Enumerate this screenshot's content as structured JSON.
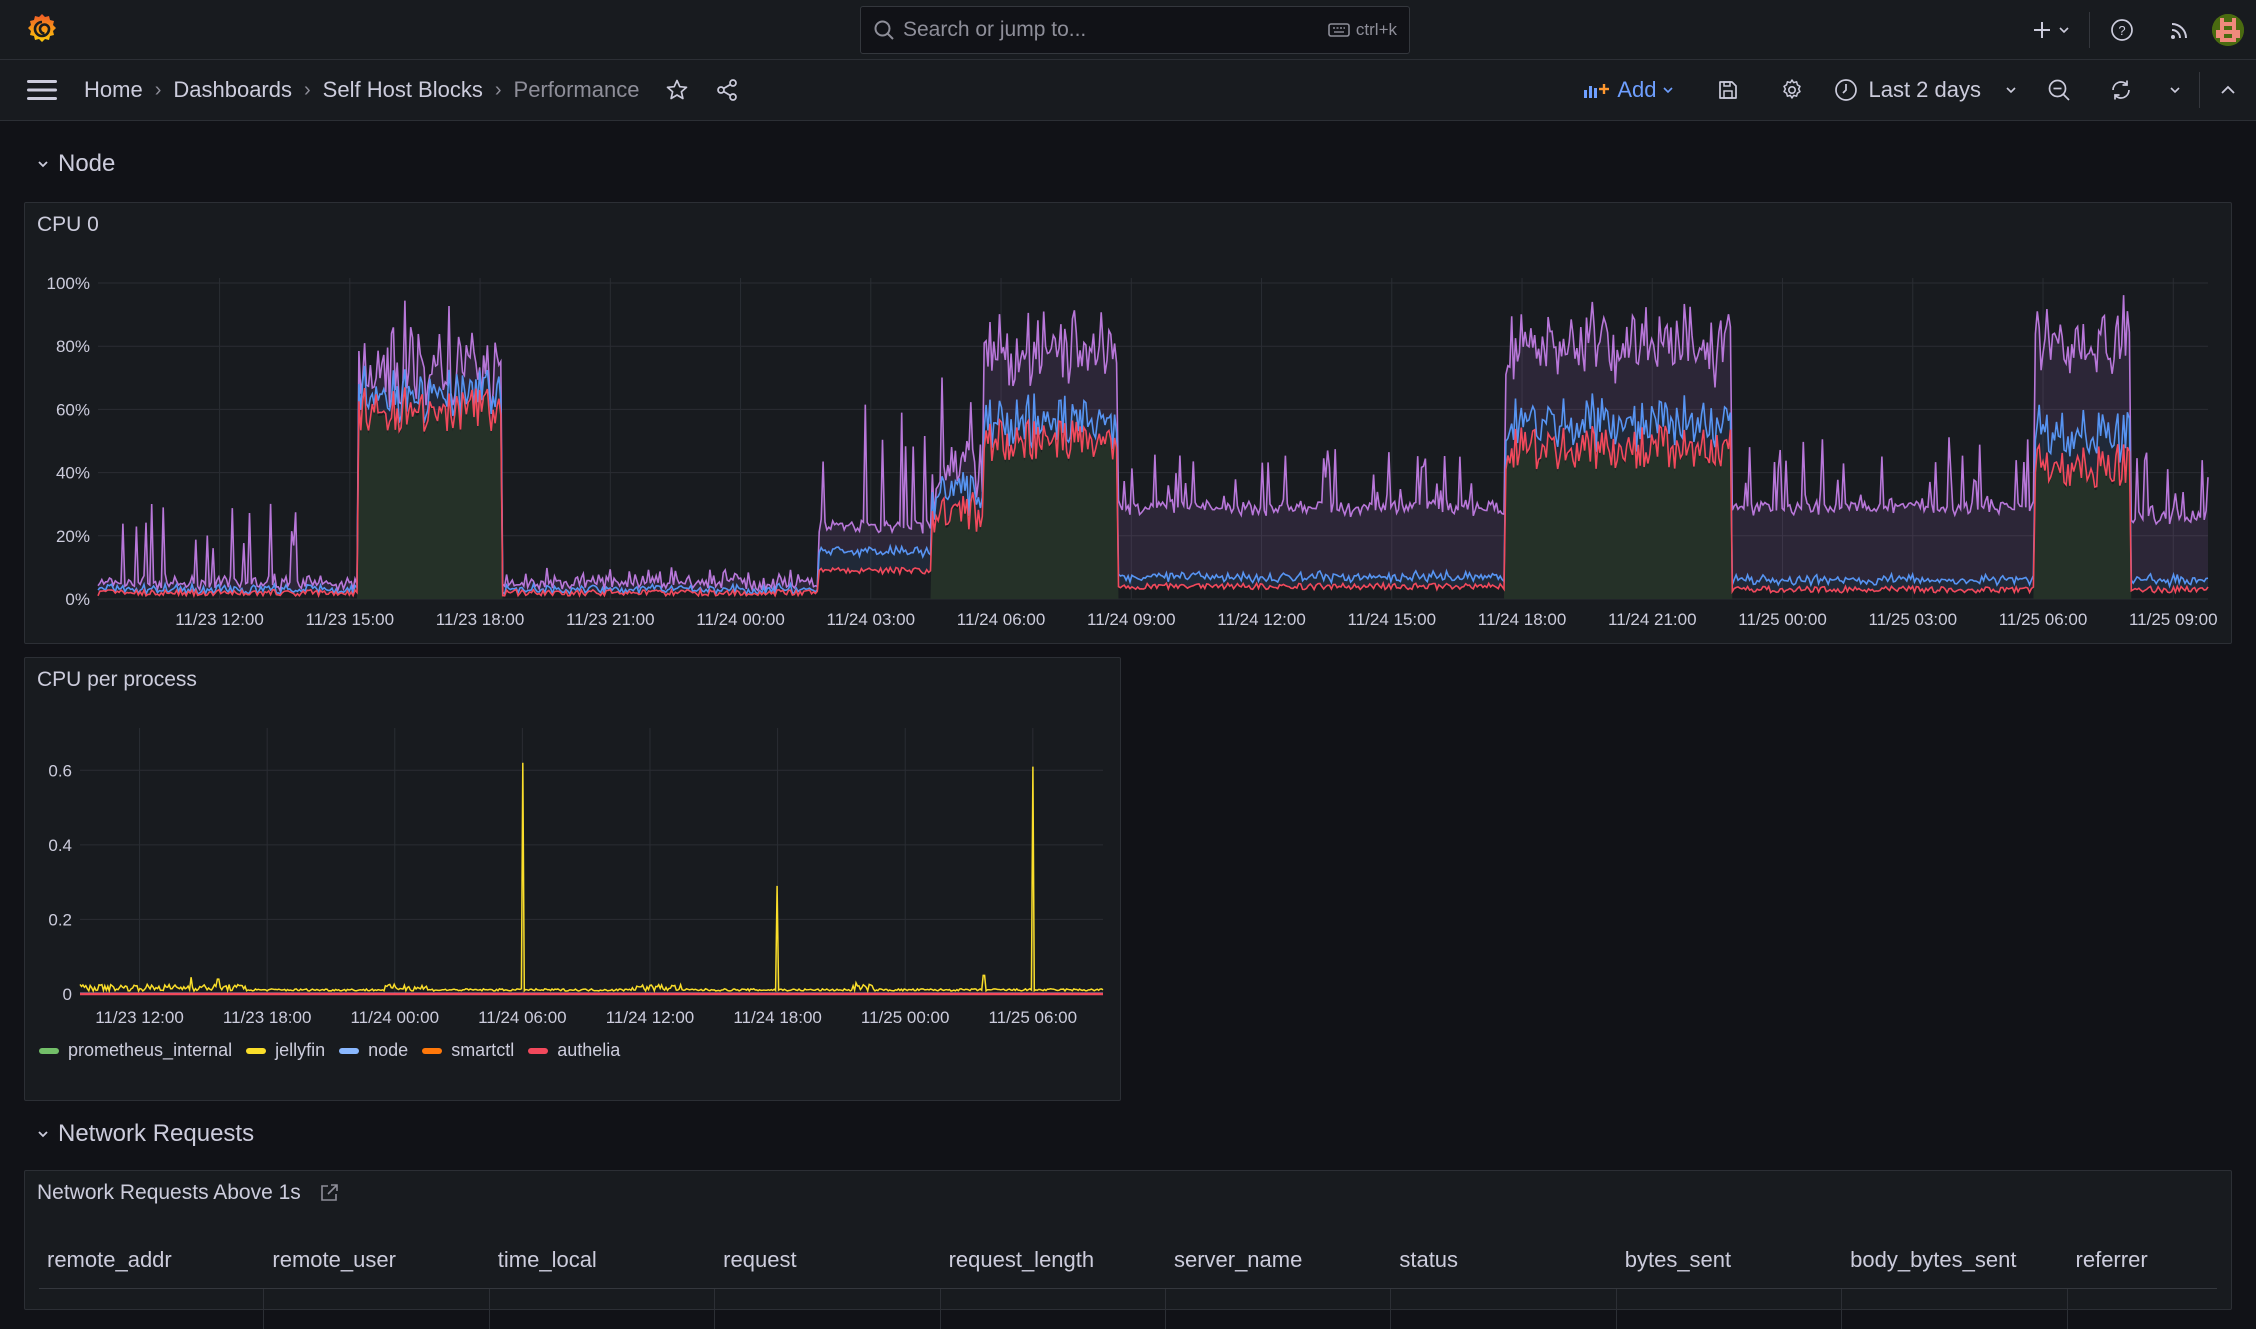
{
  "topbar": {
    "logo": "grafana-logo",
    "search_placeholder": "Search or jump to...",
    "search_shortcut": "ctrl+k",
    "icons": [
      "plus-icon",
      "chevron-down-icon",
      "help-icon",
      "rss-icon",
      "avatar"
    ]
  },
  "navbar": {
    "breadcrumbs": [
      "Home",
      "Dashboards",
      "Self Host Blocks",
      "Performance"
    ],
    "add_label": "Add",
    "time_range": "Last 2 days"
  },
  "rows": [
    {
      "title": "Node"
    },
    {
      "title": "Network Requests"
    }
  ],
  "panels": {
    "cpu0": {
      "title": "CPU 0"
    },
    "cpu_per_process": {
      "title": "CPU per process"
    },
    "network_requests": {
      "title": "Network Requests Above 1s",
      "columns": [
        "remote_addr",
        "remote_user",
        "time_local",
        "request",
        "request_length",
        "server_name",
        "status",
        "bytes_sent",
        "body_bytes_sent",
        "referrer"
      ]
    }
  },
  "colors": {
    "accent": "#6e9fff",
    "purple": "#b877d9",
    "blue": "#5794f2",
    "red": "#f2495c",
    "green_fill": "#253128",
    "jellyfin": "#fade2a",
    "prometheus_internal": "#73bf69",
    "node": "#8ab8ff",
    "smartctl": "#ff780a",
    "authelia": "#f2495c"
  },
  "chart_data": [
    {
      "type": "area",
      "title": "CPU 0",
      "ylabel": "",
      "xlabel": "",
      "ylim": [
        0,
        100
      ],
      "y_ticks": [
        "0%",
        "20%",
        "40%",
        "60%",
        "80%",
        "100%"
      ],
      "x_range_hours": [
        9.2,
        57.8
      ],
      "x_ticks": [
        {
          "h": 12,
          "label": "11/23 12:00"
        },
        {
          "h": 15,
          "label": "11/23 15:00"
        },
        {
          "h": 18,
          "label": "11/23 18:00"
        },
        {
          "h": 21,
          "label": "11/23 21:00"
        },
        {
          "h": 24,
          "label": "11/24 00:00"
        },
        {
          "h": 27,
          "label": "11/24 03:00"
        },
        {
          "h": 30,
          "label": "11/24 06:00"
        },
        {
          "h": 33,
          "label": "11/24 09:00"
        },
        {
          "h": 36,
          "label": "11/24 12:00"
        },
        {
          "h": 39,
          "label": "11/24 15:00"
        },
        {
          "h": 42,
          "label": "11/24 18:00"
        },
        {
          "h": 45,
          "label": "11/24 21:00"
        },
        {
          "h": 48,
          "label": "11/25 00:00"
        },
        {
          "h": 51,
          "label": "11/25 03:00"
        },
        {
          "h": 54,
          "label": "11/25 06:00"
        },
        {
          "h": 57,
          "label": "11/25 09:00"
        }
      ],
      "grid": true,
      "legend": "none",
      "segments": [
        {
          "from": 9.2,
          "to": 15.2,
          "base": 0,
          "red": 1,
          "blue": 2,
          "purple": 4,
          "spike": 30
        },
        {
          "from": 15.2,
          "to": 18.5,
          "base": 60,
          "red": 60,
          "blue": 65,
          "purple": 70,
          "spike": 88
        },
        {
          "from": 18.5,
          "to": 25.8,
          "base": 0,
          "red": 1,
          "blue": 2,
          "purple": 4,
          "spike": 8
        },
        {
          "from": 25.8,
          "to": 28.4,
          "base": 0,
          "red": 8,
          "blue": 14,
          "purple": 22,
          "spike": 60
        },
        {
          "from": 28.4,
          "to": 29.6,
          "base": 28,
          "red": 28,
          "blue": 34,
          "purple": 40,
          "spike": 68
        },
        {
          "from": 29.6,
          "to": 32.7,
          "base": 50,
          "red": 50,
          "blue": 56,
          "purple": 78,
          "spike": 92
        },
        {
          "from": 32.7,
          "to": 41.6,
          "base": 0,
          "red": 3,
          "blue": 6,
          "purple": 28,
          "spike": 48
        },
        {
          "from": 41.6,
          "to": 46.8,
          "base": 48,
          "red": 48,
          "blue": 56,
          "purple": 80,
          "spike": 92
        },
        {
          "from": 46.8,
          "to": 53.8,
          "base": 0,
          "red": 2,
          "blue": 5,
          "purple": 28,
          "spike": 50
        },
        {
          "from": 53.8,
          "to": 56.0,
          "base": 42,
          "red": 42,
          "blue": 52,
          "purple": 80,
          "spike": 90
        },
        {
          "from": 56.0,
          "to": 57.8,
          "base": 0,
          "red": 2,
          "blue": 5,
          "purple": 25,
          "spike": 48
        }
      ]
    },
    {
      "type": "line",
      "title": "CPU per process",
      "ylim": [
        0,
        0.7
      ],
      "y_ticks": [
        "0",
        "0.2",
        "0.4",
        "0.6"
      ],
      "x_range_hours": [
        9.2,
        57.3
      ],
      "x_ticks": [
        {
          "h": 12,
          "label": "11/23 12:00"
        },
        {
          "h": 18,
          "label": "11/23 18:00"
        },
        {
          "h": 24,
          "label": "11/24 00:00"
        },
        {
          "h": 30,
          "label": "11/24 06:00"
        },
        {
          "h": 36,
          "label": "11/24 12:00"
        },
        {
          "h": 42,
          "label": "11/24 18:00"
        },
        {
          "h": 48,
          "label": "11/25 00:00"
        },
        {
          "h": 54,
          "label": "11/25 06:00"
        }
      ],
      "grid": true,
      "legend": "bottom-left",
      "series": [
        {
          "name": "prometheus_internal",
          "color": "#73bf69",
          "baseline": 0.001
        },
        {
          "name": "jellyfin",
          "color": "#fade2a",
          "baseline": 0.008,
          "spikes": [
            {
              "h": 30,
              "v": 0.62
            },
            {
              "h": 42,
              "v": 0.29
            },
            {
              "h": 54,
              "v": 0.61
            },
            {
              "h": 51.7,
              "v": 0.05
            },
            {
              "h": 14.4,
              "v": 0.045
            },
            {
              "h": 15.7,
              "v": 0.04
            },
            {
              "h": 45.7,
              "v": 0.03
            }
          ]
        },
        {
          "name": "node",
          "color": "#8ab8ff",
          "baseline": 0.002
        },
        {
          "name": "smartctl",
          "color": "#ff780a",
          "baseline": 0.0
        },
        {
          "name": "authelia",
          "color": "#f2495c",
          "baseline": 0.0
        }
      ]
    }
  ]
}
